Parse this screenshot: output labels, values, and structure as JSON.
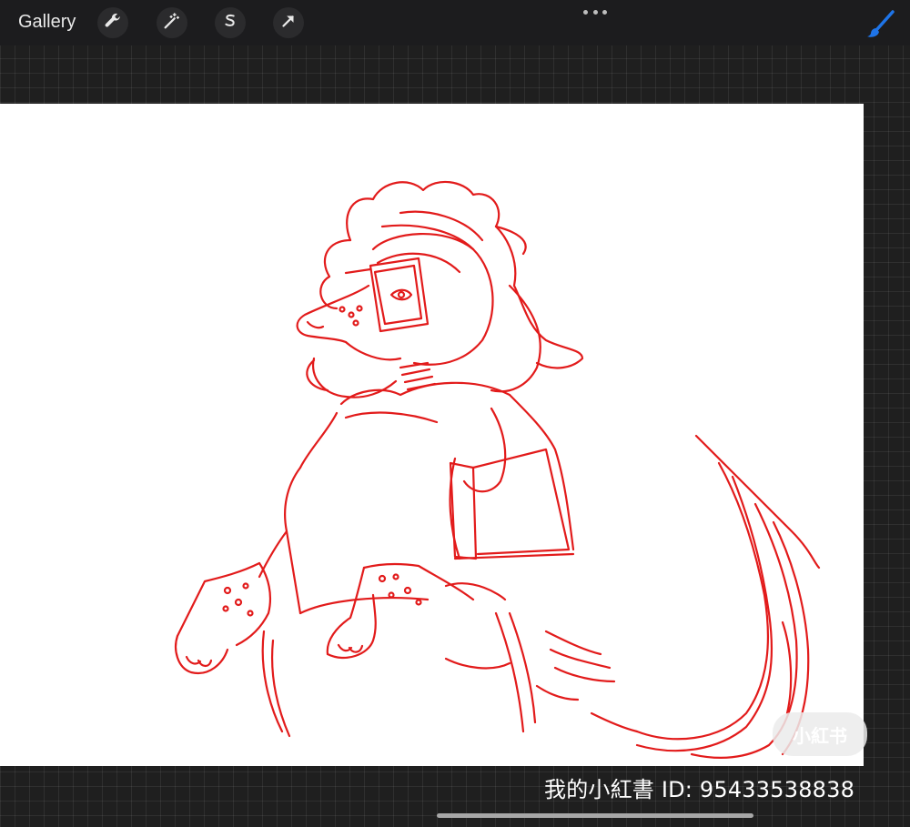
{
  "toolbar": {
    "gallery_label": "Gallery",
    "tools": [
      {
        "name": "actions",
        "icon": "wrench-icon"
      },
      {
        "name": "adjustments",
        "icon": "magic-wand-icon"
      },
      {
        "name": "selection",
        "icon": "selection-s-icon"
      },
      {
        "name": "transform",
        "icon": "transform-arrow-icon"
      }
    ],
    "more_icon": "more-dots-icon",
    "brush_icon": "brush-icon",
    "accent_color": "#1e74e8"
  },
  "canvas": {
    "background": "#ffffff",
    "stroke_color": "#e21b1b"
  },
  "watermark": {
    "logo_text": "小紅书",
    "id_text": "我的小紅書 ID: 95433538838"
  }
}
